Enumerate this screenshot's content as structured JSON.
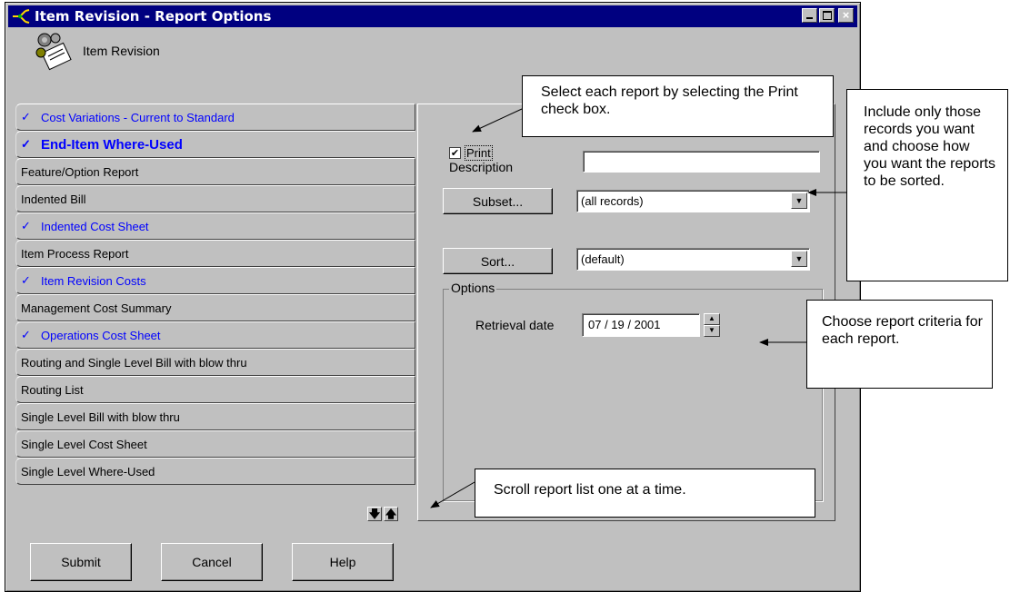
{
  "window": {
    "title": "Item Revision - Report Options"
  },
  "header": {
    "label": "Item Revision"
  },
  "reports": [
    {
      "label": "Cost Variations - Current to Standard",
      "printed": true,
      "active": false
    },
    {
      "label": "End-Item Where-Used",
      "printed": true,
      "active": true
    },
    {
      "label": "Feature/Option Report",
      "printed": false,
      "active": false
    },
    {
      "label": "Indented Bill",
      "printed": false,
      "active": false
    },
    {
      "label": "Indented Cost Sheet",
      "printed": true,
      "active": false
    },
    {
      "label": "Item Process Report",
      "printed": false,
      "active": false
    },
    {
      "label": "Item Revision Costs",
      "printed": true,
      "active": false
    },
    {
      "label": "Management Cost Summary",
      "printed": false,
      "active": false
    },
    {
      "label": "Operations Cost Sheet",
      "printed": true,
      "active": false
    },
    {
      "label": "Routing and Single Level Bill with blow thru",
      "printed": false,
      "active": false
    },
    {
      "label": "Routing List",
      "printed": false,
      "active": false
    },
    {
      "label": "Single Level Bill with blow thru",
      "printed": false,
      "active": false
    },
    {
      "label": "Single Level Cost Sheet",
      "printed": false,
      "active": false
    },
    {
      "label": "Single Level Where-Used",
      "printed": false,
      "active": false
    }
  ],
  "panel": {
    "print_label": "Print",
    "description_label": "Description",
    "description_value": "",
    "subset_button": "Subset...",
    "subset_value": "(all records)",
    "sort_button": "Sort...",
    "sort_value": "(default)",
    "options_legend": "Options",
    "retrieval_label": "Retrieval date",
    "retrieval_value": "07 / 19 / 2001"
  },
  "buttons": {
    "submit": "Submit",
    "cancel": "Cancel",
    "help": "Help"
  },
  "callouts": {
    "print": "Select each report by selecting the Print check box.",
    "subset": "Include only those records you want and choose how you want the reports to be sorted.",
    "criteria": "Choose report criteria for each report.",
    "scroll": "Scroll report list one at a time."
  },
  "icons": {
    "check": "✓",
    "print_check": "✔",
    "scroll_down": "🡇",
    "scroll_up": "🡅"
  }
}
